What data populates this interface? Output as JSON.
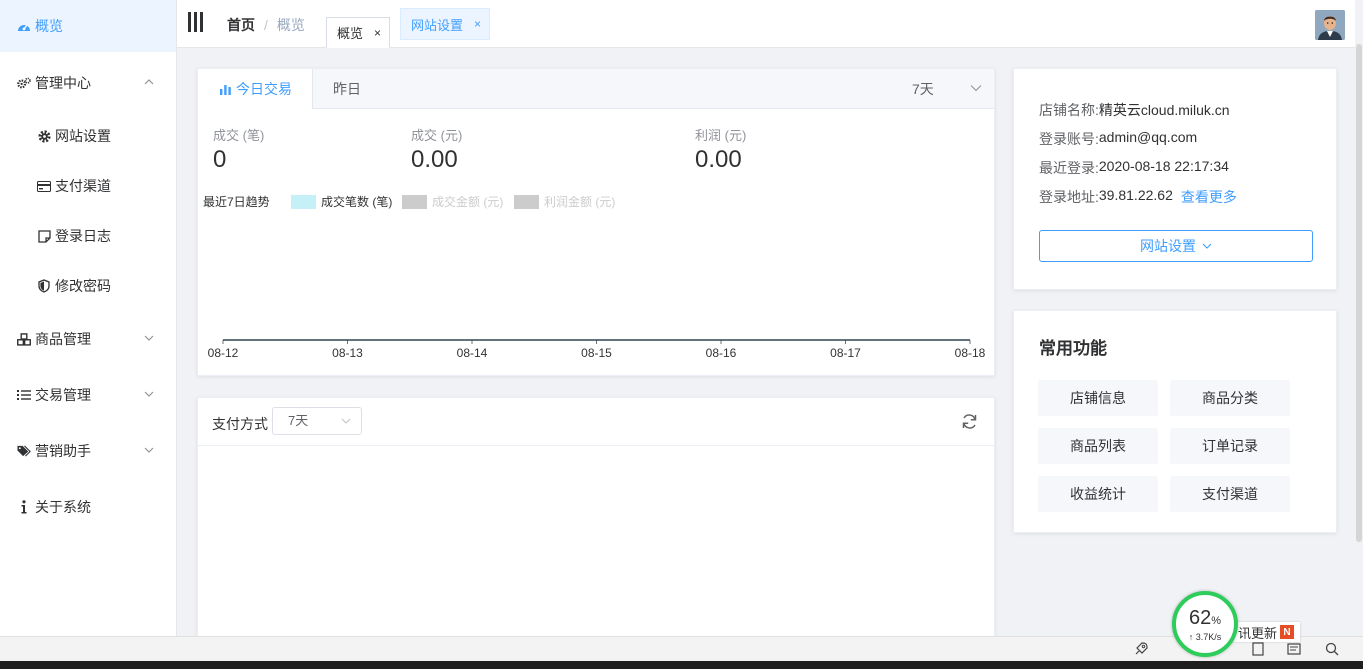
{
  "sidebar": {
    "items": [
      {
        "label": "概览",
        "icon": "dashboard-icon",
        "active": true
      },
      {
        "label": "管理中心",
        "icon": "cogs-icon",
        "expanded": true
      },
      {
        "label": "网站设置",
        "icon": "gear-icon"
      },
      {
        "label": "支付渠道",
        "icon": "credit-card-icon"
      },
      {
        "label": "登录日志",
        "icon": "note-icon"
      },
      {
        "label": "修改密码",
        "icon": "shield-icon"
      },
      {
        "label": "商品管理",
        "icon": "cubes-icon"
      },
      {
        "label": "交易管理",
        "icon": "list-icon"
      },
      {
        "label": "营销助手",
        "icon": "tags-icon"
      },
      {
        "label": "关于系统",
        "icon": "info-icon"
      }
    ]
  },
  "header": {
    "breadcrumb_home": "首页",
    "breadcrumb_sep": "/",
    "breadcrumb_current": "概览",
    "tabs": [
      {
        "label": "概览",
        "close": "×"
      },
      {
        "label": "网站设置",
        "close": "×"
      }
    ]
  },
  "trade": {
    "tab_today": "今日交易",
    "tab_yesterday": "昨日",
    "range": "7天",
    "stats": [
      {
        "label": "成交 (笔)",
        "value": "0"
      },
      {
        "label": "成交 (元)",
        "value": "0.00"
      },
      {
        "label": "利润 (元)",
        "value": "0.00"
      }
    ],
    "trend_title": "最近7日趋势",
    "legend": [
      {
        "name": "成交笔数 (笔)",
        "color": "#c6f0f8",
        "active": true
      },
      {
        "name": "成交金额 (元)",
        "color": "#cccccc",
        "active": false
      },
      {
        "name": "利润金额 (元)",
        "color": "#cccccc",
        "active": false
      }
    ]
  },
  "chart_data": {
    "type": "line",
    "title": "最近7日趋势",
    "categories": [
      "08-12",
      "08-13",
      "08-14",
      "08-15",
      "08-16",
      "08-17",
      "08-18"
    ],
    "series": [
      {
        "name": "成交笔数 (笔)",
        "values": [
          0,
          0,
          0,
          0,
          0,
          0,
          0
        ],
        "color": "#2f4554"
      }
    ],
    "xlabel": "",
    "ylabel": "",
    "grid": false,
    "legend_placement": "top-left"
  },
  "payment": {
    "title": "支付方式",
    "range": "7天"
  },
  "shop": {
    "rows": [
      {
        "key": "店铺名称:",
        "value": "精英云cloud.miluk.cn"
      },
      {
        "key": "登录账号:",
        "value": "admin@qq.com"
      },
      {
        "key": "最近登录:",
        "value": "2020-08-18 22:17:34"
      },
      {
        "key": "登录地址:",
        "value": "39.81.22.62"
      }
    ],
    "more_link": "查看更多",
    "site_button": "网站设置"
  },
  "functions": {
    "title": "常用功能",
    "buttons": [
      "店铺信息",
      "商品分类",
      "商品列表",
      "订单记录",
      "收益统计",
      "支付渠道"
    ]
  },
  "system": {
    "net_percent": "62",
    "net_percent_unit": "%",
    "net_speed": "↑ 3.7K/s",
    "news_label": "讯更新",
    "news_badge": "N"
  },
  "colors": {
    "accent": "#409eff",
    "active_bg": "#ecf5ff",
    "net_ring": "#2ecc5a"
  }
}
